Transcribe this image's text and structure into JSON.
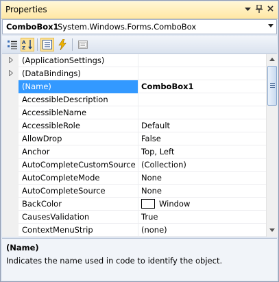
{
  "window": {
    "title": "Properties",
    "buttons": {
      "dropdown": "▼",
      "pin": "📌",
      "close": "✕"
    }
  },
  "object_selector": {
    "name": "ComboBox1",
    "type": "System.Windows.Forms.ComboBox"
  },
  "toolbar": {
    "items": [
      {
        "icon": "categorized-icon",
        "active": false
      },
      {
        "icon": "alphabetical-icon",
        "active": true
      },
      {
        "icon": "properties-icon",
        "active": true
      },
      {
        "icon": "events-icon",
        "active": false
      },
      {
        "icon": "property-pages-icon",
        "active": false
      }
    ]
  },
  "properties": [
    {
      "name": "(ApplicationSettings)",
      "value": "",
      "expandable": true
    },
    {
      "name": "(DataBindings)",
      "value": "",
      "expandable": true
    },
    {
      "name": "(Name)",
      "value": "ComboBox1",
      "selected": true
    },
    {
      "name": "AccessibleDescription",
      "value": ""
    },
    {
      "name": "AccessibleName",
      "value": ""
    },
    {
      "name": "AccessibleRole",
      "value": "Default"
    },
    {
      "name": "AllowDrop",
      "value": "False"
    },
    {
      "name": "Anchor",
      "value": "Top, Left"
    },
    {
      "name": "AutoCompleteCustomSource",
      "value": "(Collection)"
    },
    {
      "name": "AutoCompleteMode",
      "value": "None"
    },
    {
      "name": "AutoCompleteSource",
      "value": "None"
    },
    {
      "name": "BackColor",
      "value": "Window",
      "swatch": "#ffffff"
    },
    {
      "name": "CausesValidation",
      "value": "True"
    },
    {
      "name": "ContextMenuStrip",
      "value": "(none)"
    }
  ],
  "scrollbar": {
    "position": 0.0
  },
  "description": {
    "title": "(Name)",
    "text": "Indicates the name used in code to identify the object."
  },
  "colors": {
    "selection": "#3399ff",
    "title_bar": "#ffe8a6",
    "panel": "#dfe6f1"
  }
}
